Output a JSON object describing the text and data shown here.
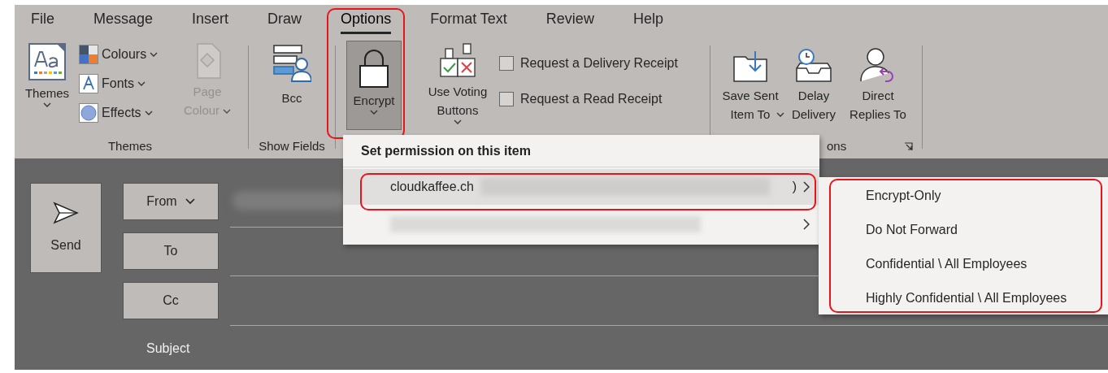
{
  "tabs": [
    {
      "label": "File",
      "selected": false
    },
    {
      "label": "Message",
      "selected": false
    },
    {
      "label": "Insert",
      "selected": false
    },
    {
      "label": "Draw",
      "selected": false
    },
    {
      "label": "Options",
      "selected": true
    },
    {
      "label": "Format Text",
      "selected": false
    },
    {
      "label": "Review",
      "selected": false
    },
    {
      "label": "Help",
      "selected": false
    }
  ],
  "themes_group": {
    "label": "Themes",
    "themes_button": "Themes",
    "options": [
      {
        "label": "Colours"
      },
      {
        "label": "Fonts"
      },
      {
        "label": "Effects"
      }
    ],
    "page_colour": {
      "label": "Page Colour",
      "disabled": true
    }
  },
  "show_fields_group": {
    "label": "Show Fields",
    "bcc_button": "Bcc"
  },
  "encrypt_button": {
    "label": "Encrypt",
    "pressed": true,
    "highlighted": true
  },
  "voting_button": "Use Voting Buttons",
  "receipts": [
    {
      "label": "Request a Delivery Receipt",
      "checked": false
    },
    {
      "label": "Request a Read Receipt",
      "checked": false
    }
  ],
  "more_options_group": {
    "label": "ons",
    "buttons": [
      {
        "label": "Save Sent Item To",
        "dropdown": true
      },
      {
        "label": "Delay Delivery",
        "dropdown": false
      },
      {
        "label": "Direct Replies To",
        "dropdown": false
      }
    ]
  },
  "compose": {
    "send_button": "Send",
    "fields": [
      {
        "label": "From",
        "dropdown": true
      },
      {
        "label": "To",
        "dropdown": false
      },
      {
        "label": "Cc",
        "dropdown": false
      }
    ],
    "subject_label": "Subject"
  },
  "permission_menu": {
    "title": "Set permission on this item",
    "items": [
      {
        "text": "cloudkaffee.ch",
        "suffix": ")",
        "selected": true,
        "highlighted": true
      },
      {
        "selected": false,
        "highlighted": false
      }
    ]
  },
  "submenu": {
    "highlighted": true,
    "items": [
      {
        "label": "Encrypt-Only"
      },
      {
        "label": "Do Not Forward"
      },
      {
        "label": "Confidential \\ All Employees"
      },
      {
        "label": "Highly Confidential \\ All Employees"
      }
    ]
  }
}
